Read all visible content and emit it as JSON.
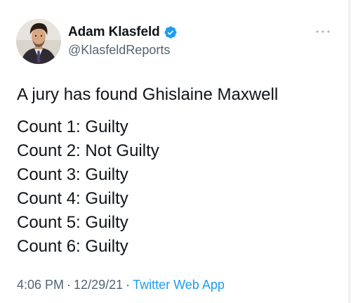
{
  "author": {
    "display_name": "Adam Klasfeld",
    "handle": "@KlasfeldReports",
    "verified": true,
    "verified_color": "#1d9bf0",
    "avatar_icon": "profile-photo"
  },
  "menu_icon": "more-horizontal-icon",
  "tweet": {
    "headline": "A jury has found Ghislaine Maxwell",
    "counts": [
      "Count 1: Guilty",
      "Count 2: Not Guilty",
      "Count 3: Guilty",
      "Count 4: Guilty",
      "Count 5: Guilty",
      "Count 6: Guilty"
    ]
  },
  "meta": {
    "time": "4:06 PM",
    "separator": "·",
    "date": "12/29/21",
    "source": "Twitter Web App",
    "source_color": "#1d9bf0"
  }
}
